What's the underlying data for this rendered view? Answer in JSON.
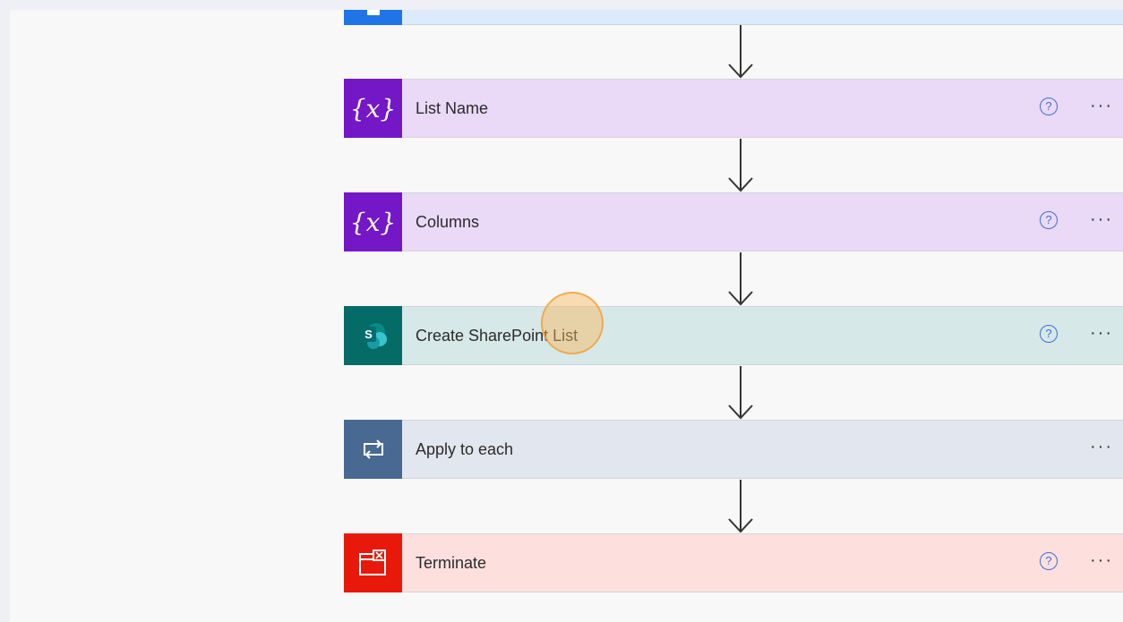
{
  "flow": {
    "top_step": {
      "label": ""
    },
    "steps": [
      {
        "label": "List Name",
        "icon": "variable-icon",
        "help": "?",
        "more": "···"
      },
      {
        "label": "Columns",
        "icon": "variable-icon",
        "help": "?",
        "more": "···"
      },
      {
        "label": "Create SharePoint List",
        "icon": "sharepoint-icon",
        "help": "?",
        "more": "···"
      },
      {
        "label": "Apply to each",
        "icon": "loop-icon",
        "more": "···"
      },
      {
        "label": "Terminate",
        "icon": "terminate-icon",
        "help": "?",
        "more": "···"
      }
    ],
    "variable_glyph": "{x}",
    "sharepoint_letter": "S"
  },
  "colors": {
    "variable_accent": "#7317c7",
    "variable_bg": "#ead9f7",
    "sharepoint_accent": "#056b66",
    "sharepoint_bg": "#d7e8e8",
    "loop_accent": "#486991",
    "loop_bg": "#e2e6ee",
    "terminate_accent": "#e8180b",
    "terminate_bg": "#fde0de",
    "help_blue": "#3b6fd8"
  }
}
